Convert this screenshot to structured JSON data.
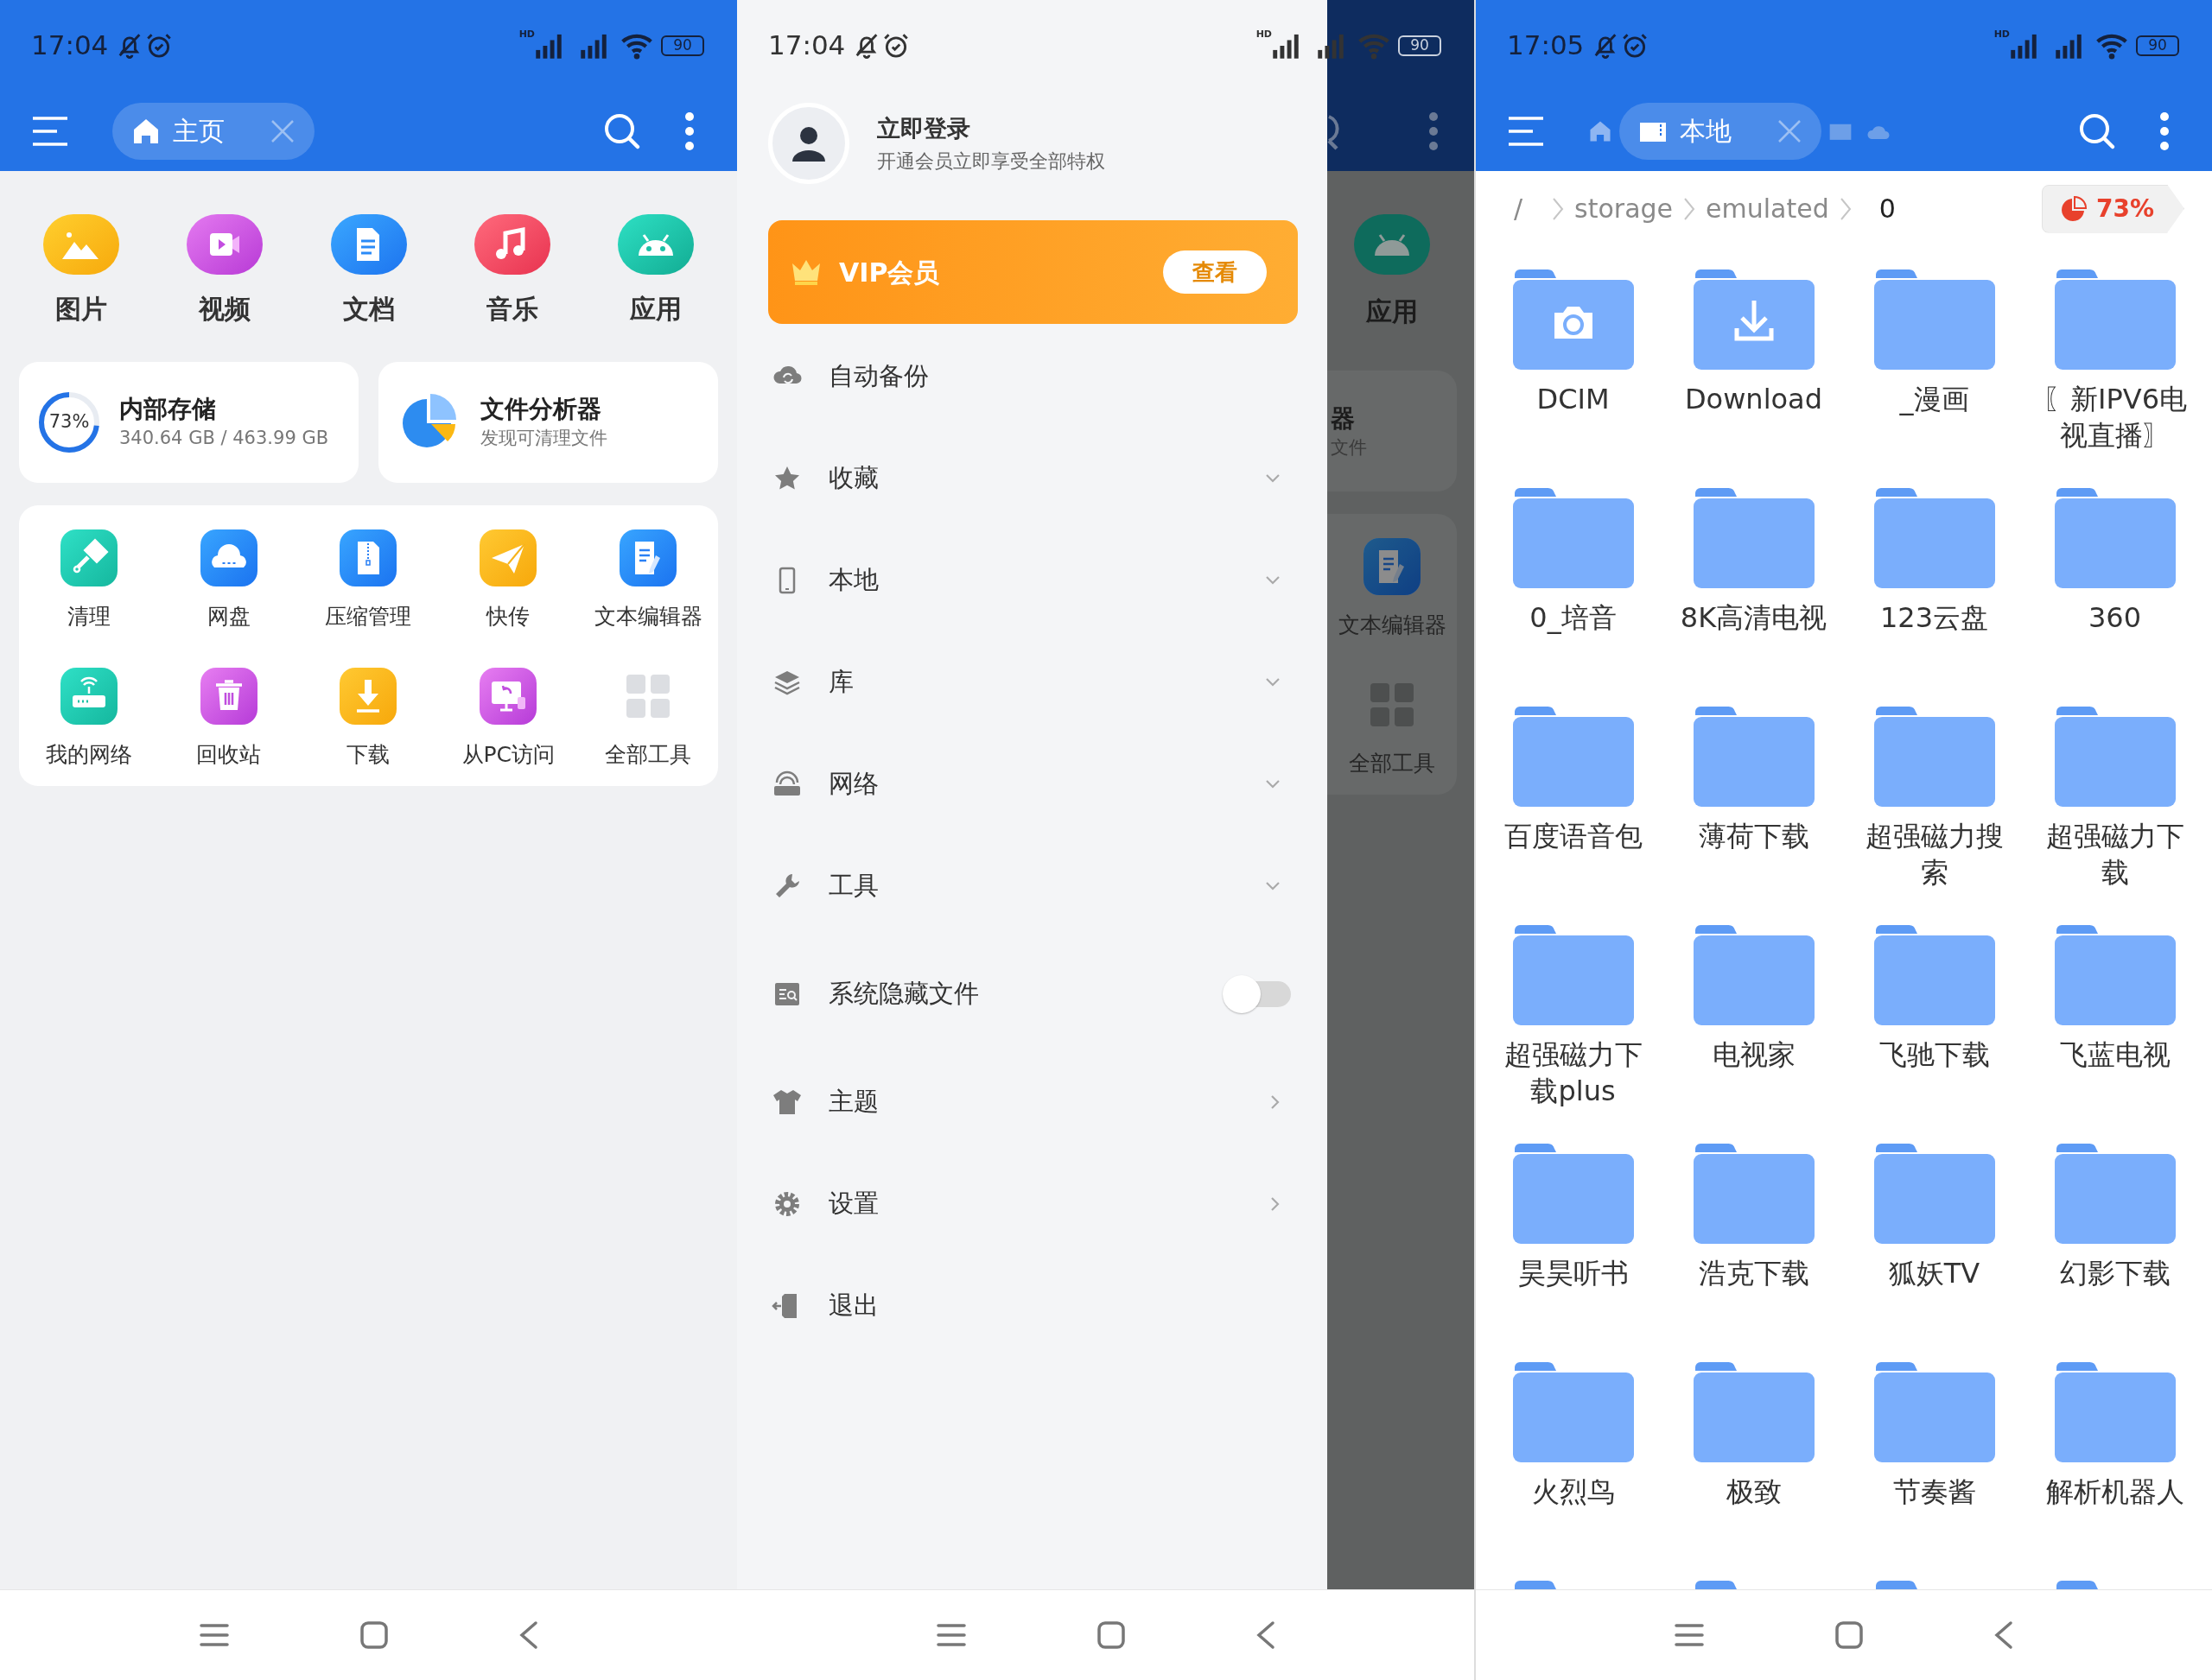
{
  "home_screen": {
    "status_bar": {
      "time": "17:04",
      "network": "HD",
      "battery": "90"
    },
    "toolbar": {
      "tab": {
        "label": "主页"
      }
    },
    "categories": [
      {
        "label": "图片",
        "kind": "image"
      },
      {
        "label": "视频",
        "kind": "video"
      },
      {
        "label": "文档",
        "kind": "document"
      },
      {
        "label": "音乐",
        "kind": "music"
      },
      {
        "label": "应用",
        "kind": "app"
      }
    ],
    "storage_card": {
      "percent": "73%",
      "level": 0.73,
      "title": "内部存储",
      "detail": "340.64 GB / 463.99 GB"
    },
    "analyzer_card": {
      "title": "文件分析器",
      "subtitle": "发现可清理文件"
    },
    "tools": [
      {
        "label": "清理",
        "kind": "clean"
      },
      {
        "label": "网盘",
        "kind": "cloud"
      },
      {
        "label": "压缩管理",
        "kind": "zip"
      },
      {
        "label": "快传",
        "kind": "send"
      },
      {
        "label": "文本编辑器",
        "kind": "editor"
      },
      {
        "label": "我的网络",
        "kind": "router"
      },
      {
        "label": "回收站",
        "kind": "trash"
      },
      {
        "label": "下载",
        "kind": "download"
      },
      {
        "label": "从PC访问",
        "kind": "pc"
      },
      {
        "label": "全部工具",
        "kind": "grid"
      }
    ]
  },
  "drawer_screen": {
    "status_bar": {
      "time": "17:04",
      "network": "HD",
      "battery": "90"
    },
    "account": {
      "title": "立即登录",
      "subtitle": "开通会员立即享受全部特权"
    },
    "vip_banner": {
      "title": "VIP会员",
      "button": "查看"
    },
    "menu": [
      {
        "label": "自动备份",
        "kind": "plain"
      },
      {
        "label": "收藏",
        "kind": "expand",
        "expanded": false
      },
      {
        "label": "本地",
        "kind": "expand",
        "expanded": false
      },
      {
        "label": "库",
        "kind": "expand",
        "expanded": false
      },
      {
        "label": "网络",
        "kind": "expand",
        "expanded": false
      },
      {
        "label": "工具",
        "kind": "expand",
        "expanded": false
      },
      {
        "label": "系统隐藏文件",
        "kind": "toggle",
        "on": false
      },
      {
        "label": "主题",
        "kind": "link"
      },
      {
        "label": "设置",
        "kind": "link"
      },
      {
        "label": "退出",
        "kind": "plain"
      }
    ],
    "background_peek": {
      "app_label": "应用",
      "card_title": "器",
      "card_subtitle": "文件",
      "tool_labels": [
        "文本编辑器",
        "全部工具"
      ]
    }
  },
  "folder_screen": {
    "status_bar": {
      "time": "17:05",
      "network": "HD",
      "battery": "90"
    },
    "toolbar": {
      "tab": {
        "label": "本地"
      }
    },
    "breadcrumb": [
      {
        "label": "/",
        "selected": false
      },
      {
        "label": "storage",
        "selected": false
      },
      {
        "label": "emulated",
        "selected": false
      },
      {
        "label": "0",
        "selected": true
      }
    ],
    "storage_badge": {
      "label": "73%"
    },
    "folders": [
      {
        "name": "DCIM",
        "kind": "camera"
      },
      {
        "name": "Download",
        "kind": "download"
      },
      {
        "name": "_漫画",
        "kind": "plain"
      },
      {
        "name": "〖新IPV6电视直播〗",
        "kind": "plain"
      },
      {
        "name": "0_培音",
        "kind": "plain"
      },
      {
        "name": "8K高清电视",
        "kind": "plain"
      },
      {
        "name": "123云盘",
        "kind": "plain"
      },
      {
        "name": "360",
        "kind": "plain"
      },
      {
        "name": "百度语音包",
        "kind": "plain"
      },
      {
        "name": "薄荷下载",
        "kind": "plain"
      },
      {
        "name": "超强磁力搜索",
        "kind": "plain"
      },
      {
        "name": "超强磁力下载",
        "kind": "plain"
      },
      {
        "name": "超强磁力下载plus",
        "kind": "plain"
      },
      {
        "name": "电视家",
        "kind": "plain"
      },
      {
        "name": "飞驰下载",
        "kind": "plain"
      },
      {
        "name": "飞蓝电视",
        "kind": "plain"
      },
      {
        "name": "昊昊听书",
        "kind": "plain"
      },
      {
        "name": "浩克下载",
        "kind": "plain"
      },
      {
        "name": "狐妖TV",
        "kind": "plain"
      },
      {
        "name": "幻影下载",
        "kind": "plain"
      },
      {
        "name": "火烈鸟",
        "kind": "plain"
      },
      {
        "name": "极致",
        "kind": "plain"
      },
      {
        "name": "节奏酱",
        "kind": "plain"
      },
      {
        "name": "解析机器人",
        "kind": "plain"
      },
      {
        "kind": "plain"
      },
      {
        "kind": "plain"
      },
      {
        "kind": "plain"
      },
      {
        "kind": "plain"
      }
    ]
  }
}
